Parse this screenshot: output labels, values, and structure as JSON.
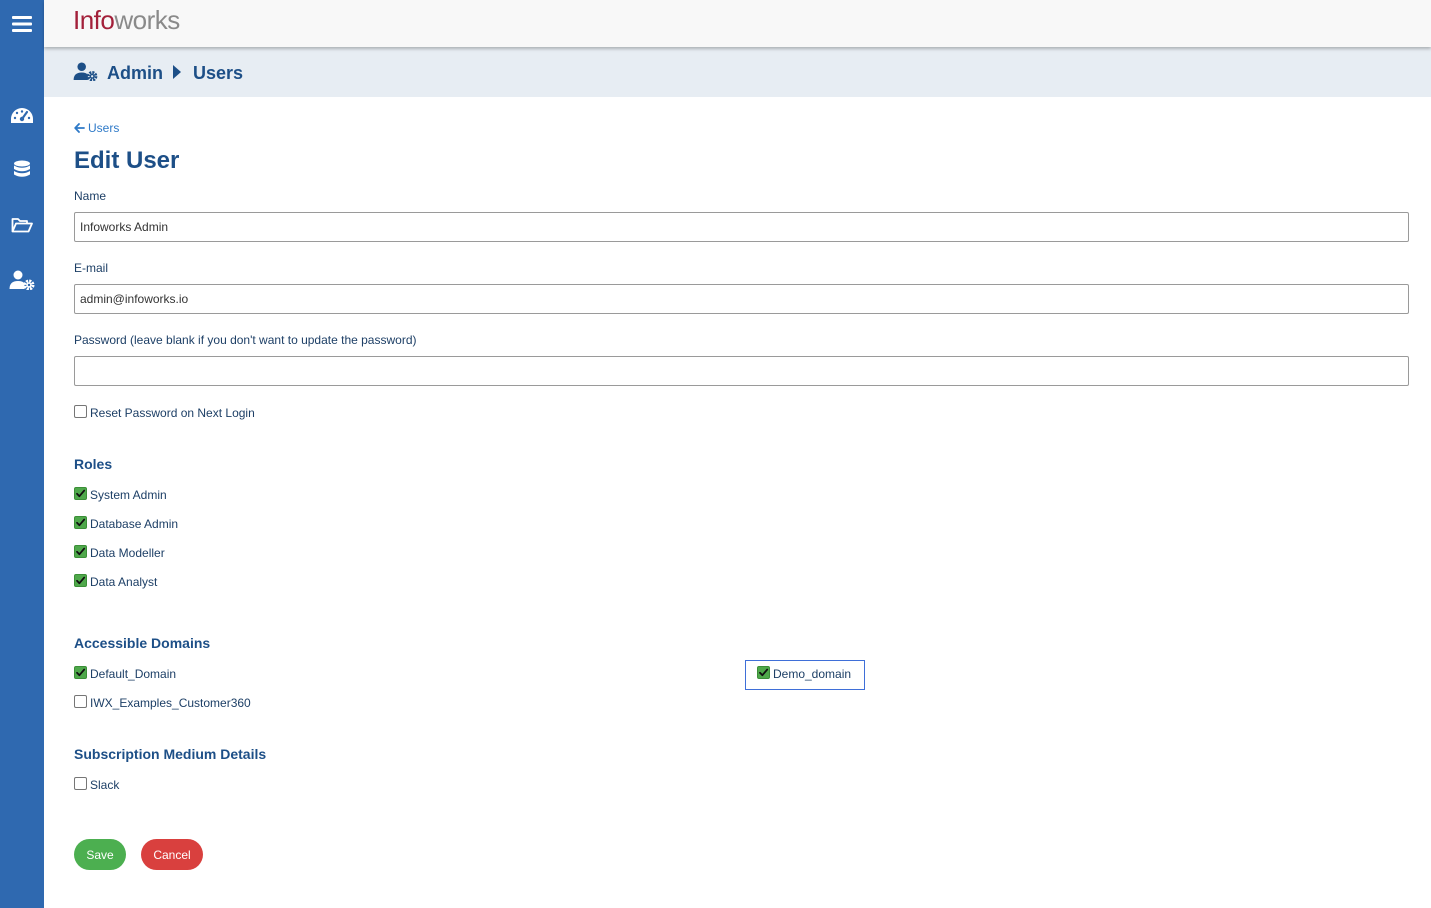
{
  "app": {
    "logo_part1": "Info",
    "logo_part2": "works"
  },
  "breadcrumb": {
    "section": "Admin",
    "page": "Users"
  },
  "back_link": "Users",
  "page_title": "Edit User",
  "form": {
    "name_label": "Name",
    "name_value": "Infoworks Admin",
    "email_label": "E-mail",
    "email_value": "admin@infoworks.io",
    "password_label": "Password (leave blank if you don't want to update the password)",
    "password_value": "",
    "reset_password_label": "Reset Password on Next Login",
    "reset_password_checked": false
  },
  "roles": {
    "heading": "Roles",
    "items": [
      {
        "label": "System Admin",
        "checked": true
      },
      {
        "label": "Database Admin",
        "checked": true
      },
      {
        "label": "Data Modeller",
        "checked": true
      },
      {
        "label": "Data Analyst",
        "checked": true
      }
    ]
  },
  "domains": {
    "heading": "Accessible Domains",
    "items": [
      {
        "label": "Default_Domain",
        "checked": true
      },
      {
        "label": "IWX_Examples_Customer360",
        "checked": false
      },
      {
        "label": "Demo_domain",
        "checked": true
      }
    ]
  },
  "subscription": {
    "heading": "Subscription Medium Details",
    "items": [
      {
        "label": "Slack",
        "checked": false
      }
    ]
  },
  "actions": {
    "save_label": "Save",
    "cancel_label": "Cancel"
  },
  "colors": {
    "sidebar": "#2f69b0",
    "heading": "#1d4f87",
    "link": "#2f7ac8",
    "check_green": "#4fa84b",
    "save": "#4caf50",
    "cancel": "#d9403e"
  }
}
